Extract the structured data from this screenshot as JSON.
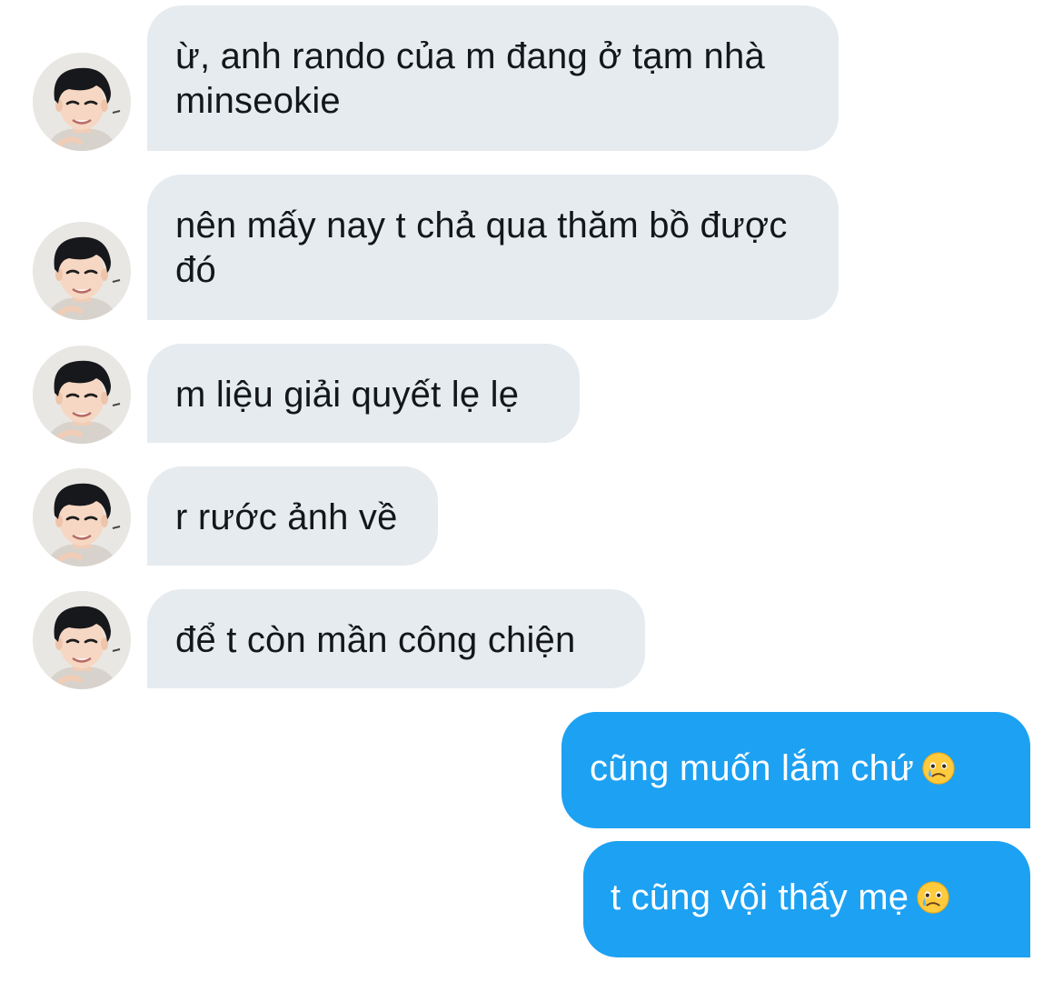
{
  "conversation": {
    "incoming": [
      {
        "text": "ừ, anh rando của m đang ở tạm nhà minseokie"
      },
      {
        "text": "nên mấy nay t chả qua thăm bồ được đó"
      },
      {
        "text": "m liệu giải quyết lẹ lẹ"
      },
      {
        "text": "r rước ảnh về"
      },
      {
        "text": "để t còn mần công chiện"
      }
    ],
    "outgoing": [
      {
        "text": "cũng muốn lắm chứ",
        "emoji": "face-holding-back-tears"
      },
      {
        "text": "t cũng vội thấy mẹ",
        "emoji": "face-holding-back-tears"
      }
    ]
  },
  "colors": {
    "incoming_bubble": "#e6ebf0",
    "incoming_text": "#14171a",
    "outgoing_bubble": "#1da1f2",
    "outgoing_text": "#ffffff"
  }
}
